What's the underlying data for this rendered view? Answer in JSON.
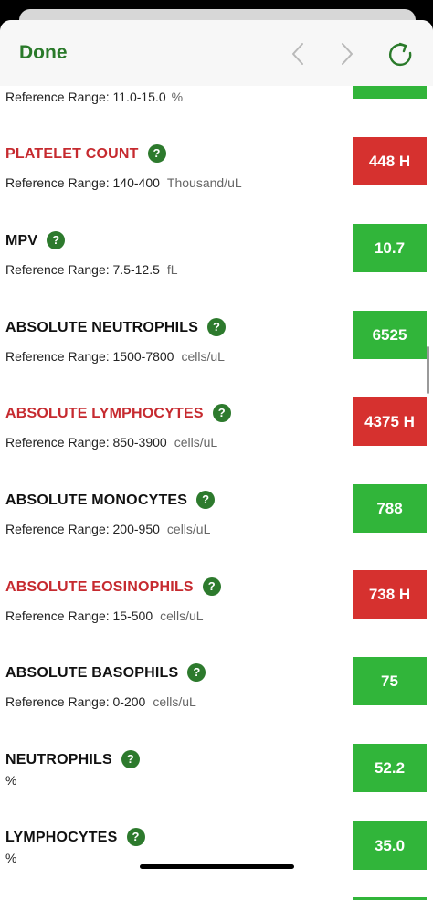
{
  "navbar": {
    "done_label": "Done"
  },
  "top_partial": {
    "ref_label": "Reference Range: 11.0-15.0",
    "unit": "%"
  },
  "help_glyph": "?",
  "results": [
    {
      "name": "PLATELET COUNT",
      "ref": "Reference Range: 140-400",
      "unit": "Thousand/uL",
      "value": "448 H",
      "flag": "high"
    },
    {
      "name": "MPV",
      "ref": "Reference Range: 7.5-12.5",
      "unit": "fL",
      "value": "10.7",
      "flag": "normal"
    },
    {
      "name": "ABSOLUTE NEUTROPHILS",
      "ref": "Reference Range: 1500-7800",
      "unit": "cells/uL",
      "value": "6525",
      "flag": "normal"
    },
    {
      "name": "ABSOLUTE LYMPHOCYTES",
      "ref": "Reference Range: 850-3900",
      "unit": "cells/uL",
      "value": "4375 H",
      "flag": "high"
    },
    {
      "name": "ABSOLUTE MONOCYTES",
      "ref": "Reference Range: 200-950",
      "unit": "cells/uL",
      "value": "788",
      "flag": "normal"
    },
    {
      "name": "ABSOLUTE EOSINOPHILS",
      "ref": "Reference Range: 15-500",
      "unit": "cells/uL",
      "value": "738 H",
      "flag": "high"
    },
    {
      "name": "ABSOLUTE BASOPHILS",
      "ref": "Reference Range: 0-200",
      "unit": "cells/uL",
      "value": "75",
      "flag": "normal"
    },
    {
      "name": "NEUTROPHILS",
      "ref": "",
      "unit": "%",
      "value": "52.2",
      "flag": "normal"
    },
    {
      "name": "LYMPHOCYTES",
      "ref": "",
      "unit": "%",
      "value": "35.0",
      "flag": "normal"
    }
  ],
  "colors": {
    "accent_green": "#2a7a2a",
    "normal": "#31b53a",
    "high": "#d6312f",
    "abnormal_text": "#c62a2f"
  }
}
